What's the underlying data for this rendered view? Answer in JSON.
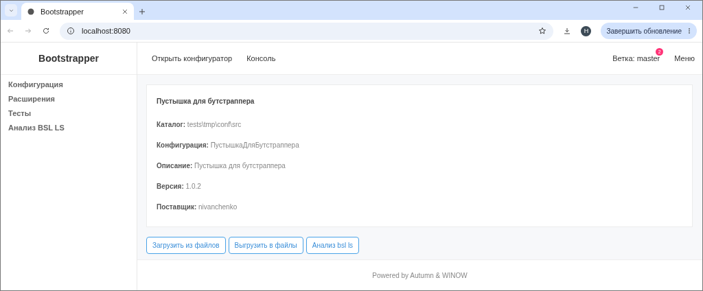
{
  "browser": {
    "tab_title": "Bootstrapper",
    "url": "localhost:8080",
    "profile_initial": "H",
    "update_button": "Завершить обновление"
  },
  "sidebar": {
    "title": "Bootstrapper",
    "items": [
      {
        "label": "Конфигурация"
      },
      {
        "label": "Расширения"
      },
      {
        "label": "Тесты"
      },
      {
        "label": "Анализ BSL LS"
      }
    ]
  },
  "header": {
    "links": [
      "Открыть конфигуратор",
      "Консоль"
    ],
    "branch": "Ветка: master",
    "branch_badge": "2",
    "menu": "Меню"
  },
  "card": {
    "title": "Пустышка для бутстраппера",
    "fields": [
      "**Каталог:** tests\\tmp\\conf\\src",
      "**Конфигурация:** ПустышкаДляБутстраппера",
      "**Описание:** Пустышка для бутстраппера",
      "**Версия:** 1.0.2",
      "**Поставщик:** nivanchenko"
    ]
  },
  "buttons": [
    "Загрузить из файлов",
    "Выгрузить в файлы",
    "Анализ bsl ls"
  ],
  "footer": "Powered by Autumn & WINOW"
}
